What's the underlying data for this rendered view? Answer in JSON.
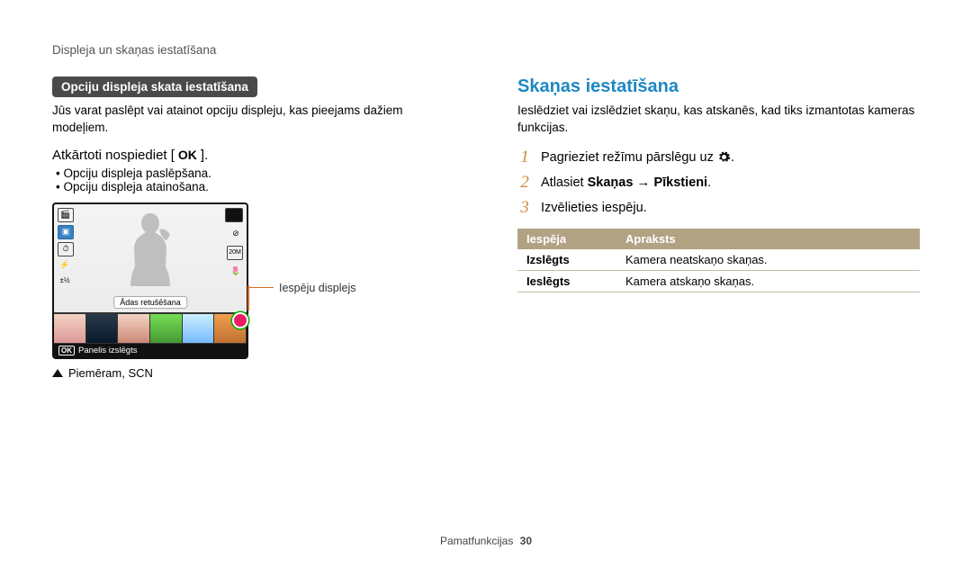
{
  "header": {
    "title": "Displeja un skaņas iestatīšana"
  },
  "left": {
    "pill": "Opciju displeja skata iestatīšana",
    "intro": "Jūs varat paslēpt vai atainot opciju displeju, kas pieejams dažiem modeļiem.",
    "instr_pre": "Atkārtoti nospiediet [",
    "instr_ok": "OK",
    "instr_post": "].",
    "bullets": [
      "Opciju displeja paslēpšana.",
      "Opciju displeja atainošana."
    ],
    "lcd": {
      "adas": "Ādas retušēšana",
      "foot_ok": "OK",
      "foot_text": "Panelis izslēgts"
    },
    "callout": "Iespēju displejs",
    "caption": "Piemēram, SCN"
  },
  "right": {
    "heading": "Skaņas iestatīšana",
    "intro": "Ieslēdziet vai izslēdziet skaņu, kas atskanēs, kad tiks izmantotas kameras funkcijas.",
    "steps": [
      {
        "n": "1",
        "pre": "Pagrieziet režīmu pārslēgu uz ",
        "icon": "gear",
        "post": "."
      },
      {
        "n": "2",
        "pre": "Atlasiet ",
        "b1": "Skaņas",
        "arrow": "→",
        "b2": "Pīkstieni",
        "post": "."
      },
      {
        "n": "3",
        "pre": "Izvēlieties iespēju.",
        "post": ""
      }
    ],
    "table": {
      "h1": "Iespēja",
      "h2": "Apraksts",
      "rows": [
        {
          "a": "Izslēgts",
          "b": "Kamera neatskaņo skaņas."
        },
        {
          "a": "Ieslēgts",
          "b": "Kamera atskaņo skaņas."
        }
      ]
    }
  },
  "footer": {
    "section": "Pamatfunkcijas",
    "page": "30"
  }
}
